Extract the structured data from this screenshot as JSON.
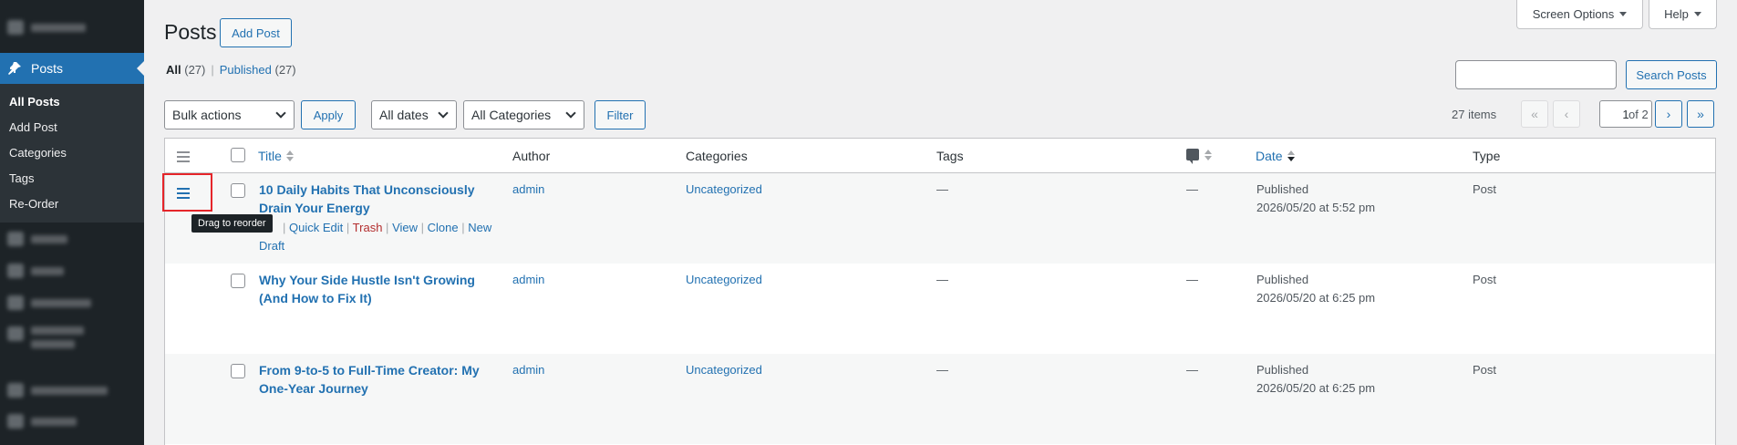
{
  "sidebar": {
    "active_item": "Posts",
    "submenu": [
      "All Posts",
      "Add Post",
      "Categories",
      "Tags",
      "Re-Order"
    ]
  },
  "header": {
    "title": "Posts",
    "add_button": "Add Post",
    "screen_options": "Screen Options",
    "help": "Help"
  },
  "views": {
    "all_label": "All",
    "all_count": "(27)",
    "separator": "|",
    "published_label": "Published",
    "published_count": "(27)"
  },
  "search": {
    "value": "",
    "button": "Search Posts"
  },
  "filters": {
    "bulk_actions": "Bulk actions",
    "apply": "Apply",
    "dates": "All dates",
    "categories": "All Categories",
    "filter": "Filter"
  },
  "pagination": {
    "items": "27 items",
    "first": "«",
    "prev": "‹",
    "current_page": "1",
    "of_total": "of 2",
    "next": "›",
    "last": "»"
  },
  "table": {
    "columns": {
      "title": "Title",
      "author": "Author",
      "categories": "Categories",
      "tags": "Tags",
      "date": "Date",
      "type": "Type"
    },
    "rows": [
      {
        "title": "10 Daily Habits That Unconsciously Drain Your Energy",
        "author": "admin",
        "categories": "Uncategorized",
        "tags": "—",
        "comments": "—",
        "status": "Published",
        "date": "2026/05/20 at 5:52 pm",
        "type": "Post",
        "actions": {
          "quick_edit": "Quick Edit",
          "trash": "Trash",
          "view": "View",
          "clone": "Clone",
          "new_draft": "New Draft",
          "separator": "|"
        }
      },
      {
        "title": "Why Your Side Hustle Isn't Growing (And How to Fix It)",
        "author": "admin",
        "categories": "Uncategorized",
        "tags": "—",
        "comments": "—",
        "status": "Published",
        "date": "2026/05/20 at 6:25 pm",
        "type": "Post"
      },
      {
        "title": "From 9-to-5 to Full-Time Creator: My One-Year Journey",
        "author": "admin",
        "categories": "Uncategorized",
        "tags": "—",
        "comments": "—",
        "status": "Published",
        "date": "2026/05/20 at 6:25 pm",
        "type": "Post"
      }
    ]
  },
  "tooltip": "Drag to reorder",
  "colors": {
    "accent": "#2271b1",
    "sidebar_bg": "#1d2327",
    "highlight": "#e5252a",
    "trash": "#b32d2e"
  }
}
